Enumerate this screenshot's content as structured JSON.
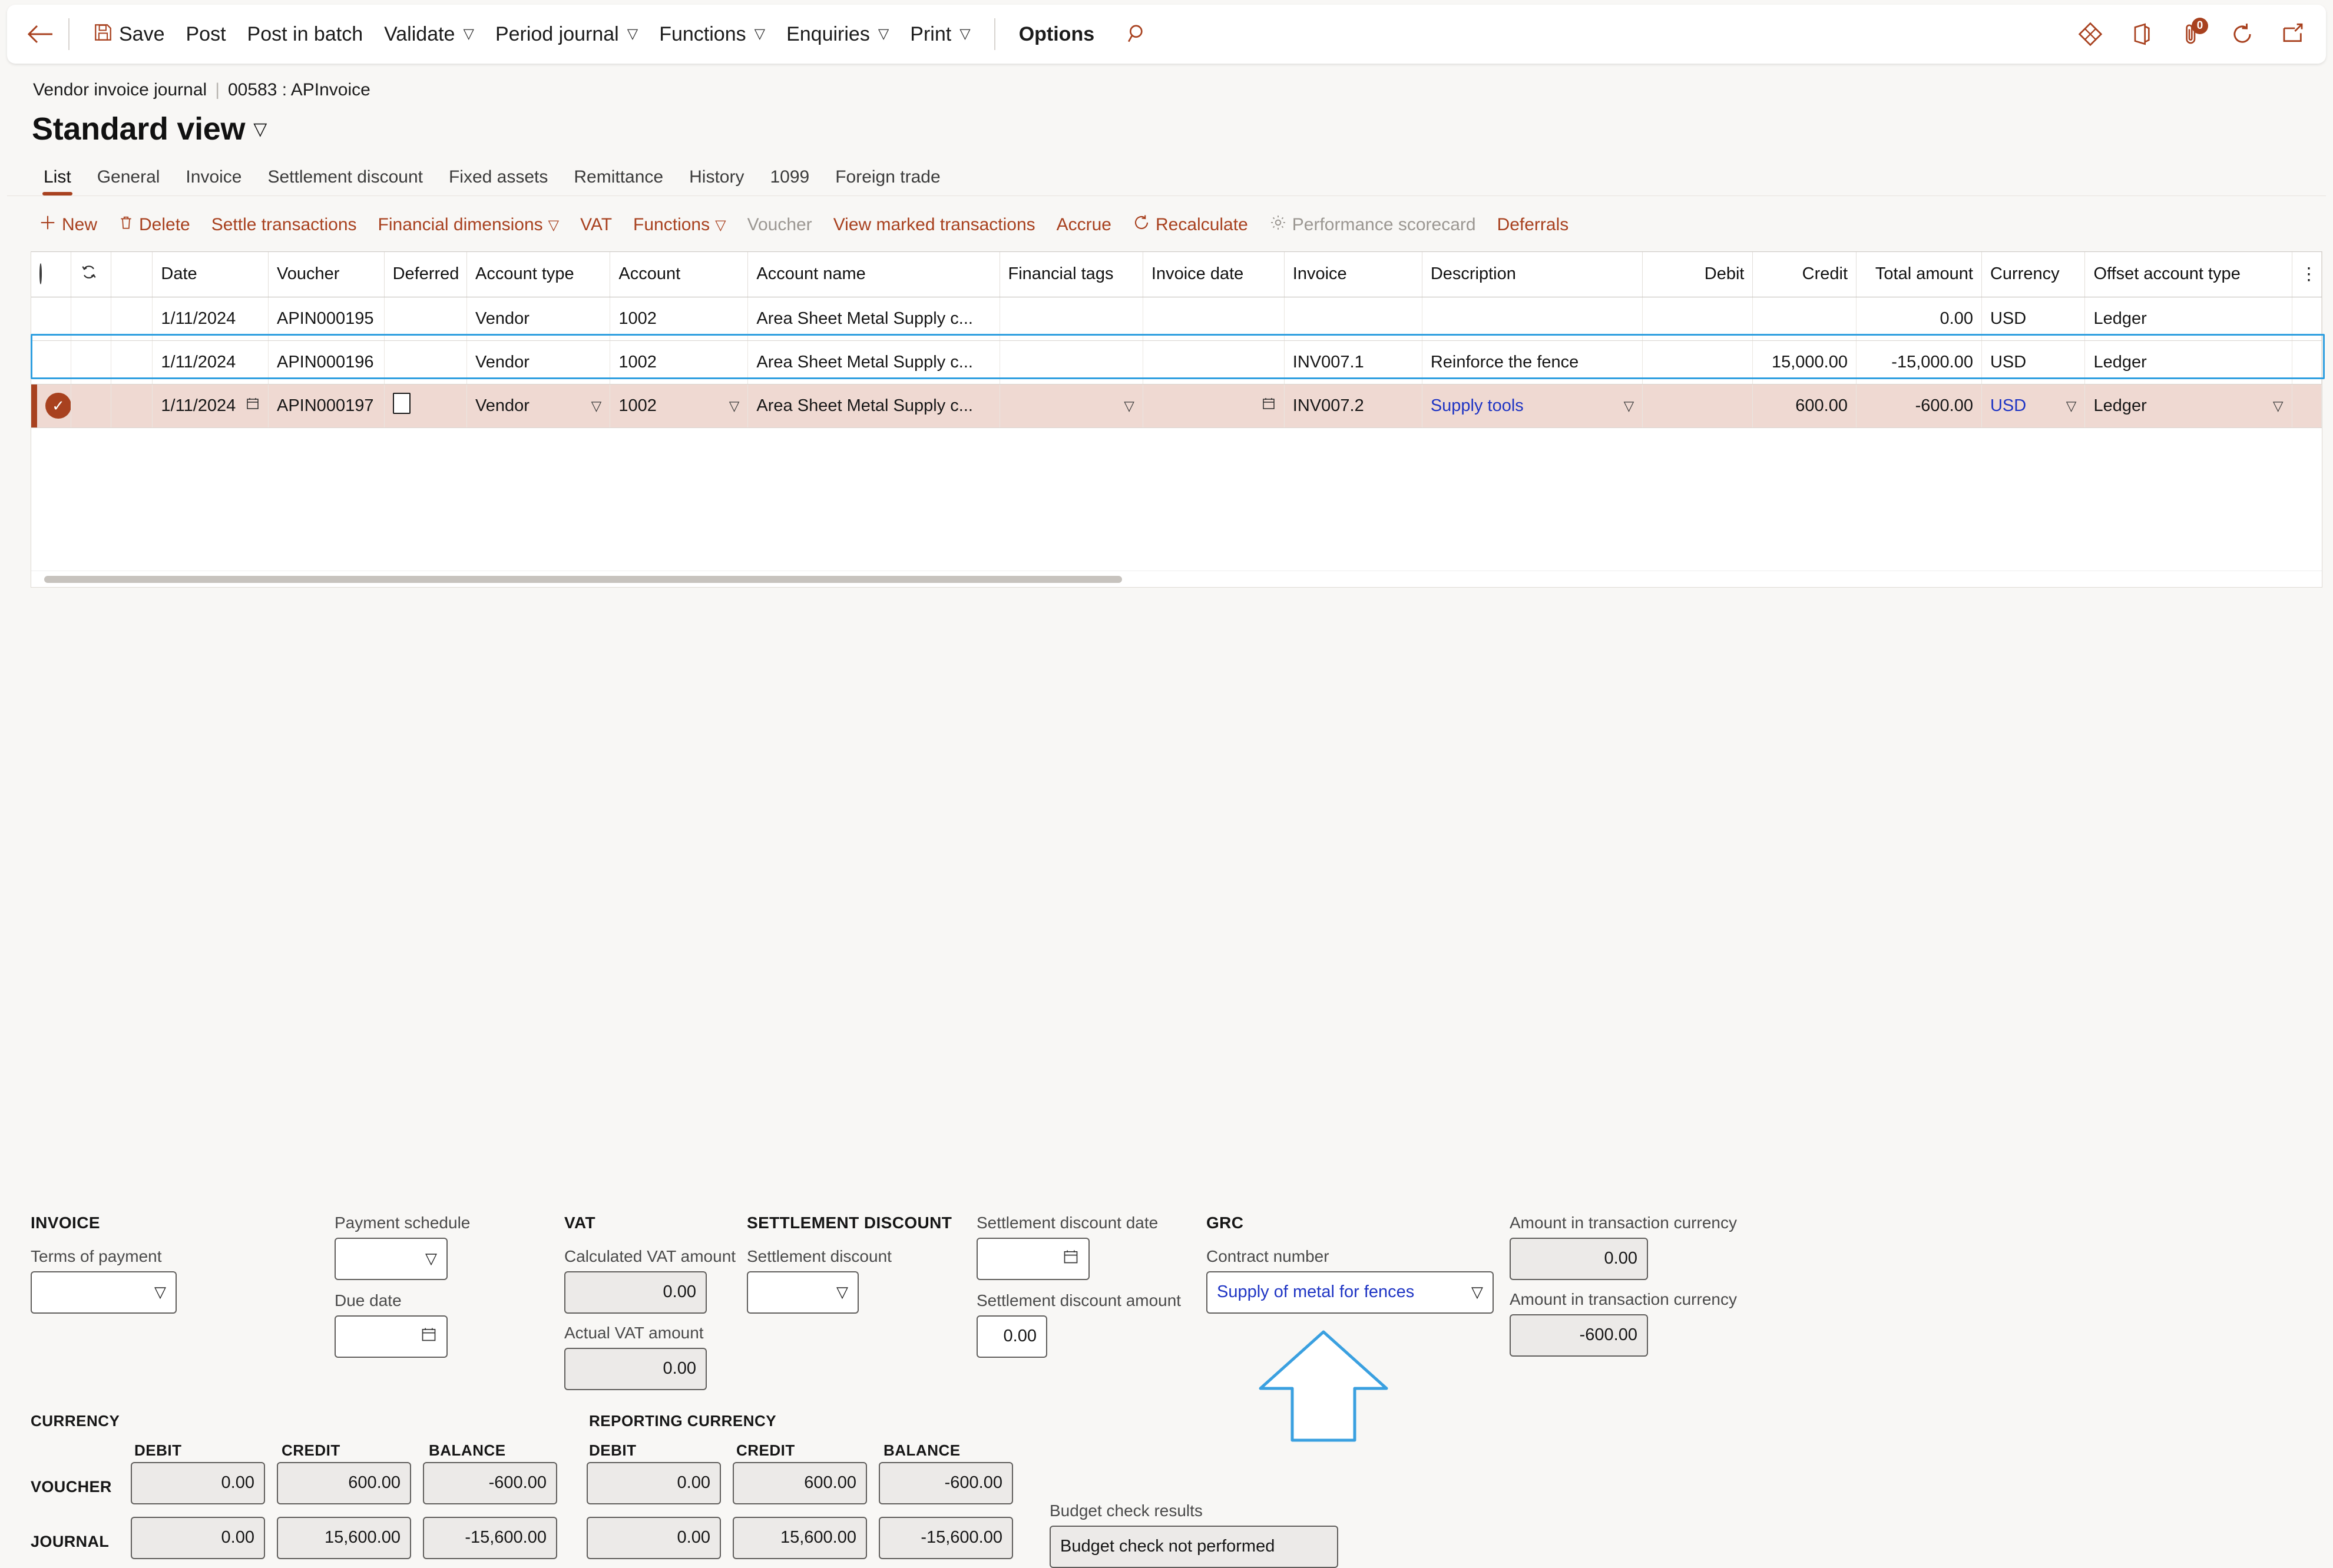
{
  "toolbar": {
    "back_icon": "back-arrow-icon",
    "save_label": "Save",
    "save_icon": "save-disk-icon",
    "items": [
      {
        "label": "Post",
        "chevron": false
      },
      {
        "label": "Post in batch",
        "chevron": false
      },
      {
        "label": "Validate",
        "chevron": true
      },
      {
        "label": "Period journal",
        "chevron": true
      },
      {
        "label": "Functions",
        "chevron": true
      },
      {
        "label": "Enquiries",
        "chevron": true
      },
      {
        "label": "Print",
        "chevron": true
      }
    ],
    "options_label": "Options",
    "search_icon": "search-icon",
    "right_icons": [
      {
        "name": "dynamics-logo-icon"
      },
      {
        "name": "office-app-launcher-icon"
      },
      {
        "name": "attachment-icon",
        "badge": "0"
      },
      {
        "name": "refresh-icon"
      },
      {
        "name": "open-in-new-window-icon"
      }
    ]
  },
  "breadcrumb": {
    "parent": "Vendor invoice journal",
    "separator": "|",
    "current": "00583 : APInvoice"
  },
  "page": {
    "title": "Standard view",
    "chevron": "⌄"
  },
  "tabs": [
    {
      "label": "List",
      "active": true
    },
    {
      "label": "General",
      "active": false
    },
    {
      "label": "Invoice",
      "active": false
    },
    {
      "label": "Settlement discount",
      "active": false
    },
    {
      "label": "Fixed assets",
      "active": false
    },
    {
      "label": "Remittance",
      "active": false
    },
    {
      "label": "History",
      "active": false
    },
    {
      "label": "1099",
      "active": false
    },
    {
      "label": "Foreign trade",
      "active": false
    }
  ],
  "action_pane": [
    {
      "label": "New",
      "icon": "plus-icon",
      "disabled": false,
      "chevron": false
    },
    {
      "label": "Delete",
      "icon": "trash-icon",
      "disabled": false,
      "chevron": false
    },
    {
      "label": "Settle transactions",
      "icon": "",
      "disabled": false,
      "chevron": false
    },
    {
      "label": "Financial dimensions",
      "icon": "",
      "disabled": false,
      "chevron": true
    },
    {
      "label": "VAT",
      "icon": "",
      "disabled": false,
      "chevron": false
    },
    {
      "label": "Functions",
      "icon": "",
      "disabled": false,
      "chevron": true
    },
    {
      "label": "Voucher",
      "icon": "",
      "disabled": true,
      "chevron": false
    },
    {
      "label": "View marked transactions",
      "icon": "",
      "disabled": false,
      "chevron": false
    },
    {
      "label": "Accrue",
      "icon": "",
      "disabled": false,
      "chevron": false
    },
    {
      "label": "Recalculate",
      "icon": "recalculate-icon",
      "disabled": false,
      "chevron": false
    },
    {
      "label": "Performance scorecard",
      "icon": "gear-icon",
      "disabled": true,
      "chevron": false
    },
    {
      "label": "Deferrals",
      "icon": "",
      "disabled": false,
      "chevron": false
    }
  ],
  "grid": {
    "headers": {
      "select": "",
      "refresh": "",
      "blank": "",
      "date": "Date",
      "voucher": "Voucher",
      "deferred": "Deferred",
      "account_type": "Account type",
      "account": "Account",
      "account_name": "Account name",
      "financial_tags": "Financial tags",
      "invoice_date": "Invoice date",
      "invoice": "Invoice",
      "description": "Description",
      "debit": "Debit",
      "credit": "Credit",
      "total_amount": "Total amount",
      "currency": "Currency",
      "offset_account_type": "Offset account type",
      "overflow": "⋮"
    },
    "rows": [
      {
        "selected": false,
        "focused": true,
        "edit": false,
        "date": "1/11/2024",
        "voucher": "APIN000195",
        "deferred": "",
        "account_type": "Vendor",
        "account": "1002",
        "account_name": "Area Sheet Metal Supply c...",
        "financial_tags": "",
        "invoice_date": "",
        "invoice": "",
        "description": "",
        "debit": "",
        "credit": "",
        "total_amount": "0.00",
        "currency": "USD",
        "offset_account_type": "Ledger"
      },
      {
        "selected": false,
        "focused": false,
        "edit": false,
        "date": "1/11/2024",
        "voucher": "APIN000196",
        "deferred": "",
        "account_type": "Vendor",
        "account": "1002",
        "account_name": "Area Sheet Metal Supply c...",
        "financial_tags": "",
        "invoice_date": "",
        "invoice": "INV007.1",
        "description": "Reinforce the fence",
        "debit": "",
        "credit": "15,000.00",
        "total_amount": "-15,000.00",
        "currency": "USD",
        "offset_account_type": "Ledger"
      },
      {
        "selected": true,
        "focused": false,
        "edit": true,
        "date": "1/11/2024",
        "voucher": "APIN000197",
        "deferred": "",
        "account_type": "Vendor",
        "account": "1002",
        "account_name": "Area Sheet Metal Supply c...",
        "financial_tags": "",
        "invoice_date": "",
        "invoice": "INV007.2",
        "description": "Supply tools",
        "debit": "",
        "credit": "600.00",
        "total_amount": "-600.00",
        "currency": "USD",
        "offset_account_type": "Ledger"
      }
    ]
  },
  "invoice_section": {
    "title": "INVOICE",
    "terms_of_payment": {
      "label": "Terms of payment",
      "value": ""
    },
    "payment_schedule": {
      "label": "Payment schedule",
      "value": ""
    },
    "due_date": {
      "label": "Due date",
      "value": ""
    }
  },
  "vat_section": {
    "title": "VAT",
    "calculated_vat_amount": {
      "label": "Calculated VAT amount",
      "value": "0.00"
    },
    "actual_vat_amount": {
      "label": "Actual VAT amount",
      "value": "0.00"
    }
  },
  "settlement_section": {
    "title": "SETTLEMENT DISCOUNT",
    "settlement_discount": {
      "label": "Settlement discount",
      "value": ""
    },
    "settlement_discount_date": {
      "label": "Settlement discount date",
      "value": ""
    },
    "settlement_discount_amount": {
      "label": "Settlement discount amount",
      "value": "0.00"
    }
  },
  "grc_section": {
    "title": "GRC",
    "contract_number": {
      "label": "Contract number",
      "value": "Supply of metal for fences"
    }
  },
  "amounts_section": {
    "amount_transaction_currency_1": {
      "label": "Amount in transaction currency",
      "value": "0.00"
    },
    "amount_transaction_currency_2": {
      "label": "Amount in transaction currency",
      "value": "-600.00"
    }
  },
  "currency_totals": {
    "title": "CURRENCY",
    "columns": [
      "DEBIT",
      "CREDIT",
      "BALANCE"
    ],
    "rows": [
      {
        "label": "VOUCHER",
        "debit": "0.00",
        "credit": "600.00",
        "balance": "-600.00"
      },
      {
        "label": "JOURNAL",
        "debit": "0.00",
        "credit": "15,600.00",
        "balance": "-15,600.00"
      }
    ]
  },
  "reporting_currency_totals": {
    "title": "REPORTING CURRENCY",
    "columns": [
      "DEBIT",
      "CREDIT",
      "BALANCE"
    ],
    "rows": [
      {
        "label": "",
        "debit": "0.00",
        "credit": "600.00",
        "balance": "-600.00"
      },
      {
        "label": "",
        "debit": "0.00",
        "credit": "15,600.00",
        "balance": "-15,600.00"
      }
    ]
  },
  "budget_check": {
    "label": "Budget check results",
    "value": "Budget check not performed"
  },
  "annotation": {
    "arrow": "up-arrow-annotation",
    "color": "#3aa0e0"
  },
  "colors": {
    "accent": "#a8411f",
    "selected_row": "#efd9d2",
    "link": "#1f35c4",
    "focus": "#2f9fe0"
  }
}
